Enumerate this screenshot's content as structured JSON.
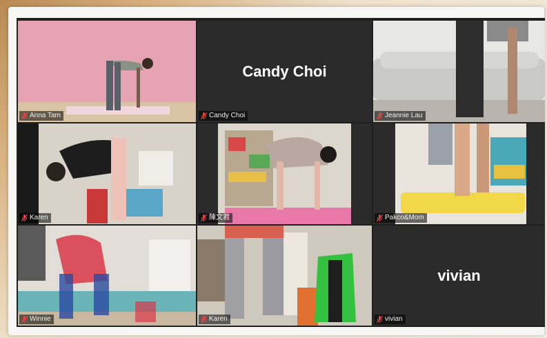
{
  "participants": [
    {
      "name": "Anna Tam",
      "mic": "mic-muted-icon",
      "video": true,
      "active_speaker": true
    },
    {
      "name": "Candy Choi",
      "mic": "mic-muted-icon",
      "video": false
    },
    {
      "name": "Jeannie Lau",
      "mic": "mic-muted-icon",
      "video": true
    },
    {
      "name": "Karen",
      "mic": "mic-muted-icon",
      "video": true
    },
    {
      "name": "陳文君",
      "mic": "mic-muted-icon",
      "video": true
    },
    {
      "name": "Pakco&Mom",
      "mic": "mic-muted-icon",
      "video": true
    },
    {
      "name": "Winnie",
      "mic": "mic-muted-icon",
      "video": true
    },
    {
      "name": "Karen",
      "mic": "mic-muted-icon",
      "video": true
    },
    {
      "name": "vivian",
      "mic": "mic-muted-icon",
      "video": false
    }
  ],
  "colors": {
    "active_speaker_border": "#c8e85a",
    "muted_mic": "#e04848",
    "tile_background": "#2b2b2b"
  }
}
